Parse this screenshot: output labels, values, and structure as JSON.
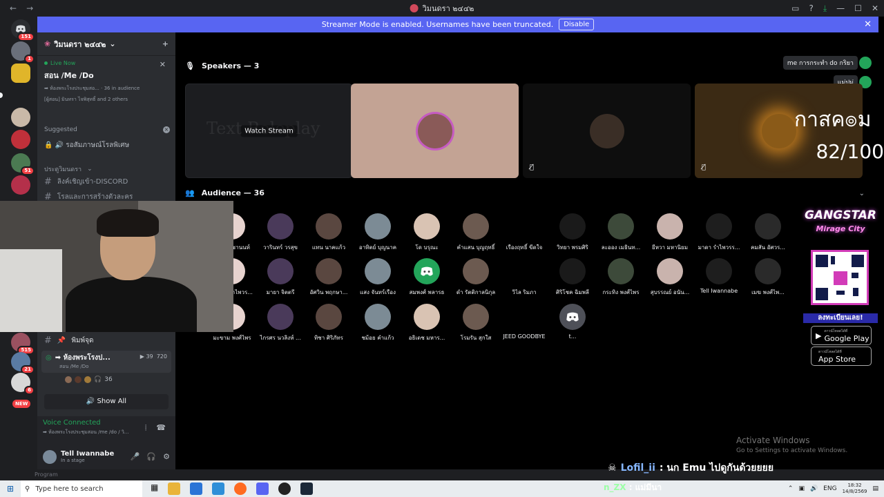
{
  "window": {
    "title": "วิมนดรา ๒๔๔๒"
  },
  "banner": {
    "text": "Streamer Mode is enabled. Usernames have been truncated.",
    "button": "Disable"
  },
  "rail": {
    "badges": [
      "151",
      "1",
      "51",
      "515",
      "21",
      "6"
    ],
    "new_label": "NEW"
  },
  "sidebar": {
    "guild_name": "วิมนดรา ๒๔๔๒",
    "live_card": {
      "status": "Live Now",
      "title": "สอน /Me /Do",
      "channel": "➡ ห้องพระโรงประชุมสอ...",
      "audience": "36 in audience",
      "people": "[ผู้สอน] มินทรา ไจพิสุทธิ์ and 2 others"
    },
    "suggested": {
      "heading": "Suggested",
      "channel": "รอสัมภาษณ์โรลพิเศษ"
    },
    "channels": [
      {
        "name": "ประตูวิมนดรา",
        "type": "category"
      },
      {
        "name": "ลิงค์เชิญเข้า-DISCORD",
        "type": "text"
      },
      {
        "name": "โรลและการสร้างตัวละคร",
        "type": "text"
      },
      {
        "name": "พิมพ์จุด",
        "type": "text"
      }
    ],
    "voice_channel": {
      "name": "➡ ห้องพระโรงป...",
      "sub": "สอน /Me /Do",
      "cams": "39",
      "count": "720",
      "listeners": "36"
    },
    "show_all": "Show All",
    "voice_connected": {
      "title": "Voice Connected",
      "sub": "➡ ห้องพระโรงประชุมสอน /me /do / วิ..."
    },
    "user": {
      "name": "Tell Iwannabe",
      "status": "In a stage"
    }
  },
  "stage": {
    "speakers_label": "Speakers — 3",
    "audience_label": "Audience — 36",
    "watch_stream": "Watch Stream",
    "ghost_text": "Text Roleplay",
    "speaker_pills": [
      "me การกระทำ do กริยา",
      "แม่ปม่"
    ],
    "audience": [
      "มีนา เดชานนท์",
      "วารินทร์ วรสุข",
      "แทน นาคแก้ว",
      "อาทิตย์ บุญนาค",
      "โด บรุณะ",
      "คำแสน บุญฤทธิ์",
      "เรืองฤทธิ์ ขีดใจ",
      "วิทยา พรมศิริ",
      "ละออง เมธินท...",
      "ยีหวา มหานิยม",
      "มาดา รำไพวรร...",
      "คมสัน อัศวร...",
      "อัญญา รำไพวร...",
      "มายา จิตตรี",
      "อัศวิน พฤกษา...",
      "แสง จันทร์เรือง",
      "สมพงศ์ พลารธ",
      "ดำ รัตติกาลนิกุล",
      "วิไล ริมภา",
      "ศิริโชค ฉิมพลี",
      "กระทิง พงศ์ไพร",
      "สุบรรณย์ อนัน...",
      "Tell Iwannabe",
      "เมฆ พงศ์ไพ...",
      "มะขาม พงศ์ไพร",
      "ไกรศร นวลิงห์ ...",
      "ทิชา ศิริภัทร",
      "ชม้อย คำแก้ว",
      "อธิเดช มหาร...",
      "โรมรัน สุกใส",
      "JEED GOODBYE",
      "t..."
    ]
  },
  "overlay": {
    "brand_logo": "กาสค๏ม",
    "brand_count": "82/100",
    "game_title": "GANGSTAR",
    "game_subtitle": "Mirage City",
    "register": "ลงทะเบียนเลย!",
    "google_play_small": "ดาวน์โหลดได้ที่",
    "google_play": "Google Play",
    "app_store_small": "ดาวน์โหลดได้ที่",
    "app_store": "App Store",
    "activate_title": "Activate Windows",
    "activate_sub": "Go to Settings to activate Windows.",
    "chat_user": "Lofil_ii",
    "chat_text": ": นก Emu ไปดูกันด้วยยยย",
    "chat2_user": "n_ZX",
    "chat2_text": ": แม่มีนา",
    "bottom_text": "Program"
  },
  "taskbar": {
    "search_placeholder": "Type here to search",
    "lang": "ENG",
    "time": "18:32",
    "date": "14/8/2569"
  },
  "colors": {
    "blurple": "#5865f2",
    "green": "#23a55a",
    "red": "#f23f43",
    "sidebar": "#2b2d31"
  }
}
